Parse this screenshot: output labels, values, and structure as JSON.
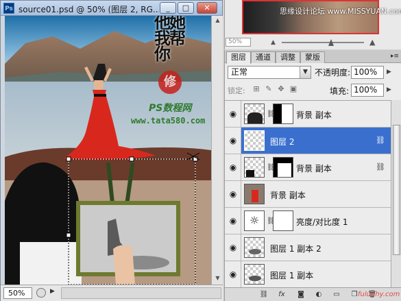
{
  "document": {
    "title": "source01.psd @ 50% (图层 2, RG...",
    "zoom": "50%",
    "calligraphy_text": "他她我帮你",
    "seal_text": "修",
    "watermark_line1": "PS数程网",
    "watermark_line2": "www.tata580.com"
  },
  "window_buttons": {
    "minimize": "_",
    "maximize": "□",
    "close": "✕"
  },
  "navigator": {
    "zoom_value": "50%",
    "watermark": "思缘设计论坛 www.MISSYUAN.com"
  },
  "layers_panel": {
    "tabs": [
      {
        "label": "图层"
      },
      {
        "label": "通道"
      },
      {
        "label": "调整"
      },
      {
        "label": "蒙版"
      }
    ],
    "blend_mode": "正常",
    "opacity_label": "不透明度:",
    "opacity_value": "100%",
    "lock_label": "锁定:",
    "fill_label": "填充:",
    "fill_value": "100%",
    "layers": [
      {
        "name": "背景 副本",
        "selected": false,
        "has_mask": true,
        "linked": false
      },
      {
        "name": "图层 2",
        "selected": true,
        "has_mask": false,
        "linked": true
      },
      {
        "name": "背景 副本",
        "selected": false,
        "has_mask": true,
        "linked": true
      },
      {
        "name": "背景 副本",
        "selected": false,
        "has_mask": false,
        "linked": false
      },
      {
        "name": "亮度/对比度 1",
        "selected": false,
        "has_mask": true,
        "linked": false
      },
      {
        "name": "图层 1 副本 2",
        "selected": false,
        "has_mask": false,
        "linked": false
      },
      {
        "name": "图层 1 副本",
        "selected": false,
        "has_mask": false,
        "linked": false
      }
    ]
  },
  "corner_watermark": "fuluphy.com",
  "colors": {
    "selected_row": "#3a6fce",
    "dress_red": "#d8281d"
  }
}
